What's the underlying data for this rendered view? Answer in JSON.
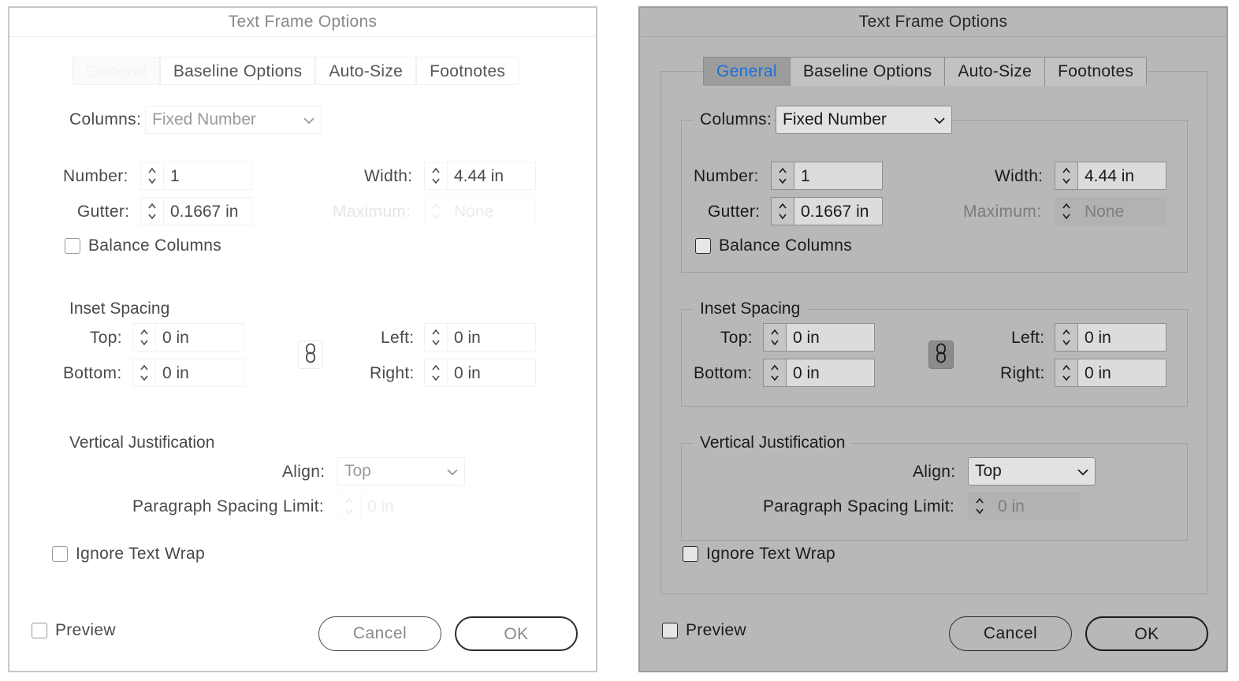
{
  "dialogs": [
    {
      "theme": "light",
      "title": "Text Frame Options",
      "tabs": [
        {
          "label": "General",
          "selected": true
        },
        {
          "label": "Baseline Options",
          "selected": false
        },
        {
          "label": "Auto-Size",
          "selected": false
        },
        {
          "label": "Footnotes",
          "selected": false
        }
      ],
      "columns": {
        "label": "Columns:",
        "type_value": "Fixed Number",
        "number_label": "Number:",
        "number_value": "1",
        "width_label": "Width:",
        "width_value": "4.44 in",
        "gutter_label": "Gutter:",
        "gutter_value": "0.1667 in",
        "maximum_label": "Maximum:",
        "maximum_value": "None",
        "balance_label": "Balance Columns",
        "balance_checked": false
      },
      "inset": {
        "title": "Inset Spacing",
        "top_label": "Top:",
        "top_value": "0 in",
        "bottom_label": "Bottom:",
        "bottom_value": "0 in",
        "left_label": "Left:",
        "left_value": "0 in",
        "right_label": "Right:",
        "right_value": "0 in"
      },
      "vj": {
        "title": "Vertical Justification",
        "align_label": "Align:",
        "align_value": "Top",
        "psl_label": "Paragraph Spacing Limit:",
        "psl_value": "0 in"
      },
      "ignore_wrap_label": "Ignore Text Wrap",
      "preview_label": "Preview",
      "cancel_label": "Cancel",
      "ok_label": "OK"
    },
    {
      "theme": "dark",
      "title": "Text Frame Options",
      "tabs": [
        {
          "label": "General",
          "selected": true
        },
        {
          "label": "Baseline Options",
          "selected": false
        },
        {
          "label": "Auto-Size",
          "selected": false
        },
        {
          "label": "Footnotes",
          "selected": false
        }
      ],
      "columns": {
        "label": "Columns:",
        "type_value": "Fixed Number",
        "number_label": "Number:",
        "number_value": "1",
        "width_label": "Width:",
        "width_value": "4.44 in",
        "gutter_label": "Gutter:",
        "gutter_value": "0.1667 in",
        "maximum_label": "Maximum:",
        "maximum_value": "None",
        "balance_label": "Balance Columns",
        "balance_checked": false
      },
      "inset": {
        "title": "Inset Spacing",
        "top_label": "Top:",
        "top_value": "0 in",
        "bottom_label": "Bottom:",
        "bottom_value": "0 in",
        "left_label": "Left:",
        "left_value": "0 in",
        "right_label": "Right:",
        "right_value": "0 in"
      },
      "vj": {
        "title": "Vertical Justification",
        "align_label": "Align:",
        "align_value": "Top",
        "psl_label": "Paragraph Spacing Limit:",
        "psl_value": "0 in"
      },
      "ignore_wrap_label": "Ignore Text Wrap",
      "preview_label": "Preview",
      "cancel_label": "Cancel",
      "ok_label": "OK"
    }
  ],
  "colors": {
    "selected_tab_text_dark": "#1e6fd6",
    "dark_dialog_bg": "#b8b8b8",
    "light_dialog_bg": "#ffffff"
  },
  "icons": [
    "chevron-down-icon",
    "up-down-arrows-icon",
    "chain-link-icon",
    "checkbox-icon"
  ]
}
